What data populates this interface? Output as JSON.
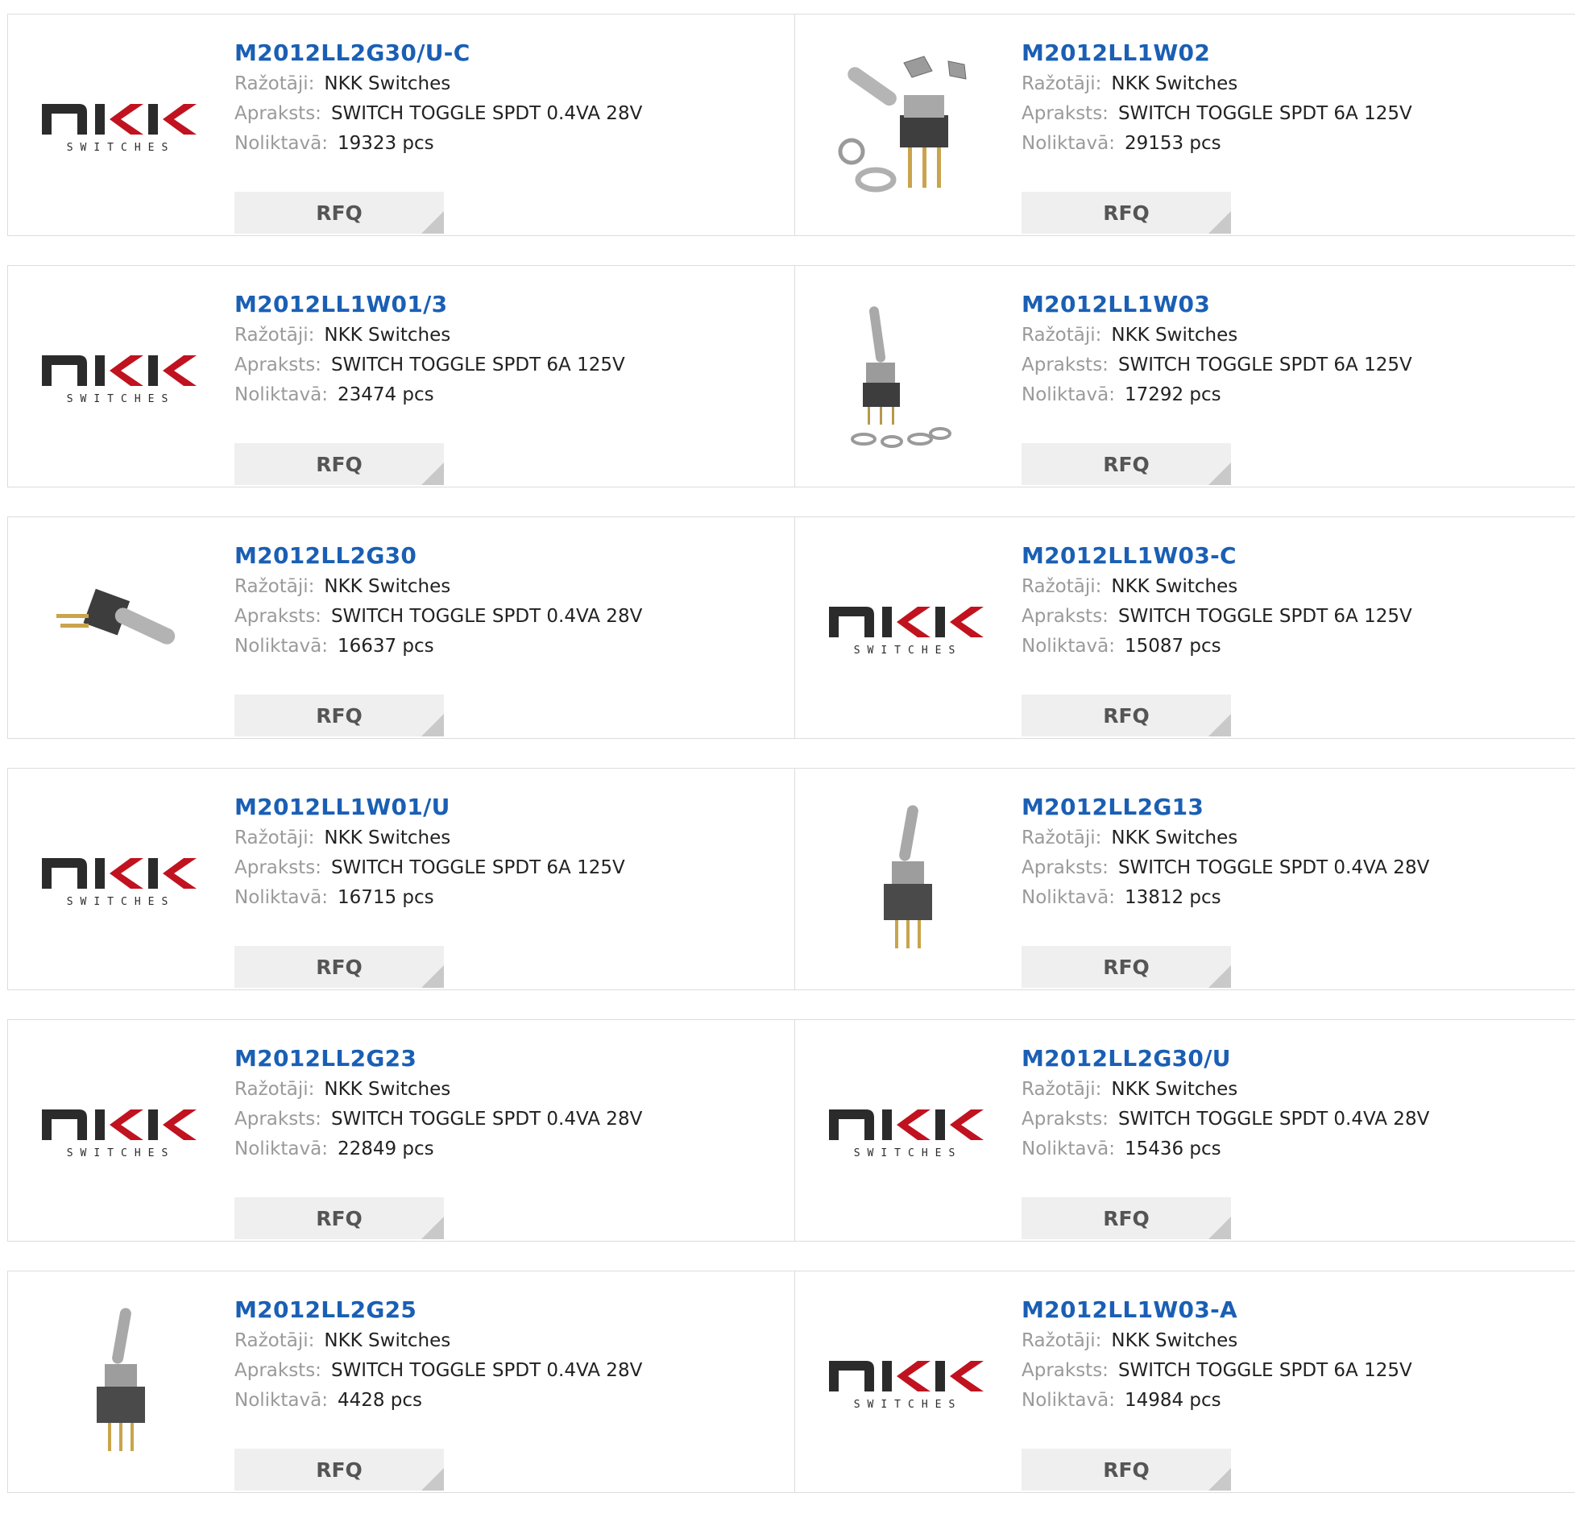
{
  "labels": {
    "manufacturer": "Ražotāji:",
    "description": "Apraksts:",
    "stock": "Noliktavā:"
  },
  "rfq_label": "RFQ",
  "logo": {
    "mark": "nkk",
    "text": "SWITCHES"
  },
  "products": [
    {
      "part": "M2012LL2G30/U-C",
      "manufacturer": "NKK Switches",
      "description": "SWITCH TOGGLE SPDT 0.4VA 28V",
      "stock": "19323 pcs",
      "image": "nkk-logo"
    },
    {
      "part": "M2012LL1W02",
      "manufacturer": "NKK Switches",
      "description": "SWITCH TOGGLE SPDT 6A 125V",
      "stock": "29153 pcs",
      "image": "toggle-switch-with-hardware-photo"
    },
    {
      "part": "M2012LL1W01/3",
      "manufacturer": "NKK Switches",
      "description": "SWITCH TOGGLE SPDT 6A 125V",
      "stock": "23474 pcs",
      "image": "nkk-logo"
    },
    {
      "part": "M2012LL1W03",
      "manufacturer": "NKK Switches",
      "description": "SWITCH TOGGLE SPDT 6A 125V",
      "stock": "17292 pcs",
      "image": "upright-toggle-switch-with-washers-photo"
    },
    {
      "part": "M2012LL2G30",
      "manufacturer": "NKK Switches",
      "description": "SWITCH TOGGLE SPDT 0.4VA 28V",
      "stock": "16637 pcs",
      "image": "right-angle-toggle-switch-photo"
    },
    {
      "part": "M2012LL1W03-C",
      "manufacturer": "NKK Switches",
      "description": "SWITCH TOGGLE SPDT 6A 125V",
      "stock": "15087 pcs",
      "image": "nkk-logo"
    },
    {
      "part": "M2012LL1W01/U",
      "manufacturer": "NKK Switches",
      "description": "SWITCH TOGGLE SPDT 6A 125V",
      "stock": "16715 pcs",
      "image": "nkk-logo"
    },
    {
      "part": "M2012LL2G13",
      "manufacturer": "NKK Switches",
      "description": "SWITCH TOGGLE SPDT 0.4VA 28V",
      "stock": "13812 pcs",
      "image": "pcb-toggle-switch-photo"
    },
    {
      "part": "M2012LL2G23",
      "manufacturer": "NKK Switches",
      "description": "SWITCH TOGGLE SPDT 0.4VA 28V",
      "stock": "22849 pcs",
      "image": "nkk-logo"
    },
    {
      "part": "M2012LL2G30/U",
      "manufacturer": "NKK Switches",
      "description": "SWITCH TOGGLE SPDT 0.4VA 28V",
      "stock": "15436 pcs",
      "image": "nkk-logo"
    },
    {
      "part": "M2012LL2G25",
      "manufacturer": "NKK Switches",
      "description": "SWITCH TOGGLE SPDT 0.4VA 28V",
      "stock": "4428 pcs",
      "image": "pcb-toggle-switch-photo"
    },
    {
      "part": "M2012LL1W03-A",
      "manufacturer": "NKK Switches",
      "description": "SWITCH TOGGLE SPDT 6A 125V",
      "stock": "14984 pcs",
      "image": "nkk-logo"
    }
  ]
}
